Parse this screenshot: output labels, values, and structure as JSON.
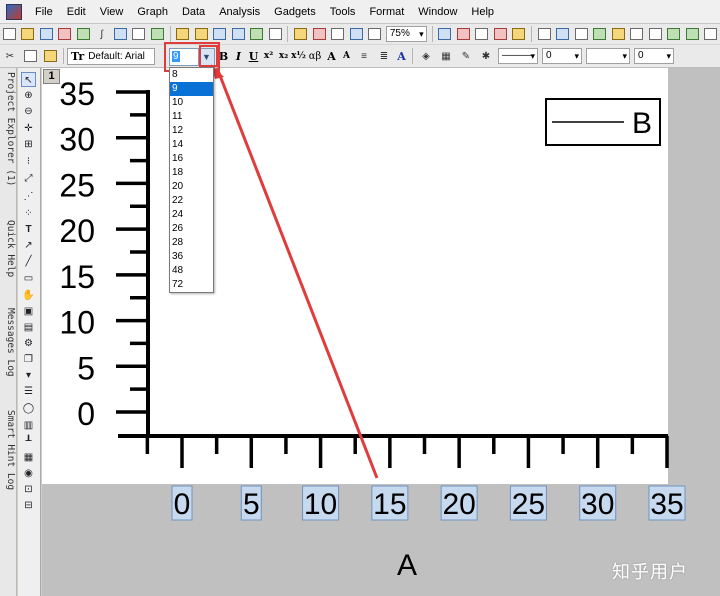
{
  "menu": [
    "File",
    "Edit",
    "View",
    "Graph",
    "Data",
    "Analysis",
    "Gadgets",
    "Tools",
    "Format",
    "Window",
    "Help"
  ],
  "toolbar": {
    "zoom": "75%",
    "font_name": "Default: Arial",
    "font_size_value": "9",
    "line_width_value": "0",
    "border_width_value": "0",
    "greek_label": "αβ"
  },
  "font_size_options": [
    "8",
    "9",
    "10",
    "11",
    "12",
    "14",
    "16",
    "18",
    "20",
    "22",
    "24",
    "26",
    "28",
    "36",
    "48",
    "72"
  ],
  "font_size_selected_index": 1,
  "side_tabs": [
    "Project Explorer (1)",
    "Quick Help",
    "Messages Log",
    "Smart Hint Log"
  ],
  "layer_number": "1",
  "chart_data": {
    "type": "line",
    "xlabel": "A",
    "ylabel": "",
    "xlim": [
      -5,
      35
    ],
    "ylim": [
      -3,
      35
    ],
    "x_ticks": [
      0,
      5,
      10,
      15,
      20,
      25,
      30,
      35
    ],
    "y_ticks": [
      0,
      5,
      10,
      15,
      20,
      25,
      30,
      35
    ],
    "series": [
      {
        "name": "B",
        "values": []
      }
    ],
    "legend": "top-right"
  },
  "colors": {
    "annotation": "#e03c3c",
    "selection": "#0a72d6",
    "tick_label_highlight": "#c7d9ee"
  },
  "watermark": "知乎用户"
}
